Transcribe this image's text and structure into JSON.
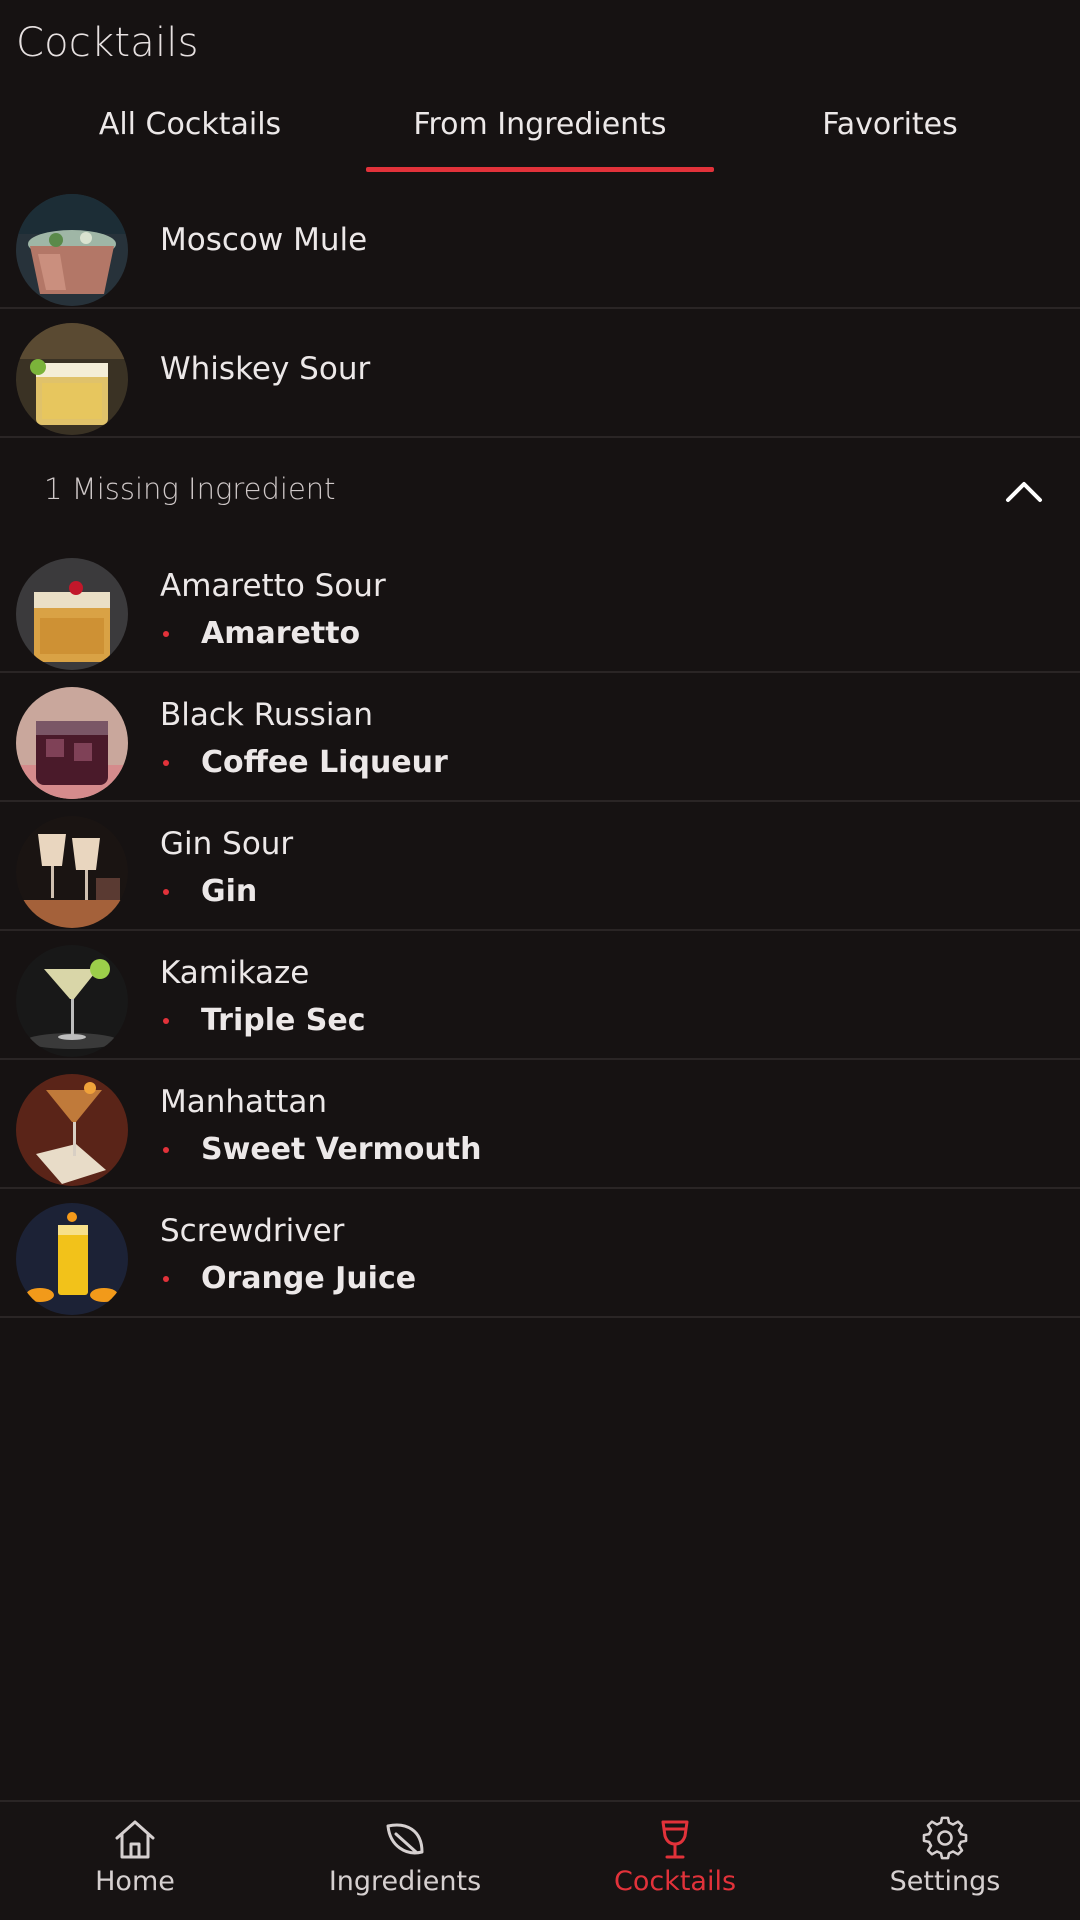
{
  "header": {
    "title": "Cocktails"
  },
  "tabs": [
    {
      "label": "All Cocktails"
    },
    {
      "label": "From Ingredients"
    },
    {
      "label": "Favorites"
    }
  ],
  "active_tab": "From Ingredients",
  "available": [
    {
      "name": "Moscow Mule"
    },
    {
      "name": "Whiskey Sour"
    }
  ],
  "missing_section": {
    "label": "1 Missing Ingredient",
    "items": [
      {
        "name": "Amaretto Sour",
        "missing": "Amaretto"
      },
      {
        "name": "Black Russian",
        "missing": "Coffee Liqueur"
      },
      {
        "name": "Gin Sour",
        "missing": "Gin"
      },
      {
        "name": "Kamikaze",
        "missing": "Triple Sec"
      },
      {
        "name": "Manhattan",
        "missing": "Sweet Vermouth"
      },
      {
        "name": "Screwdriver",
        "missing": "Orange Juice"
      }
    ]
  },
  "bottom_nav": [
    {
      "label": "Home",
      "icon": "home-icon"
    },
    {
      "label": "Ingredients",
      "icon": "leaf-icon"
    },
    {
      "label": "Cocktails",
      "icon": "cocktail-glass-icon"
    },
    {
      "label": "Settings",
      "icon": "gear-icon"
    }
  ],
  "active_nav": "Cocktails",
  "colors": {
    "background": "#161212",
    "accent": "#e2323a",
    "text": "#ece8e8",
    "divider": "#2a2525"
  }
}
